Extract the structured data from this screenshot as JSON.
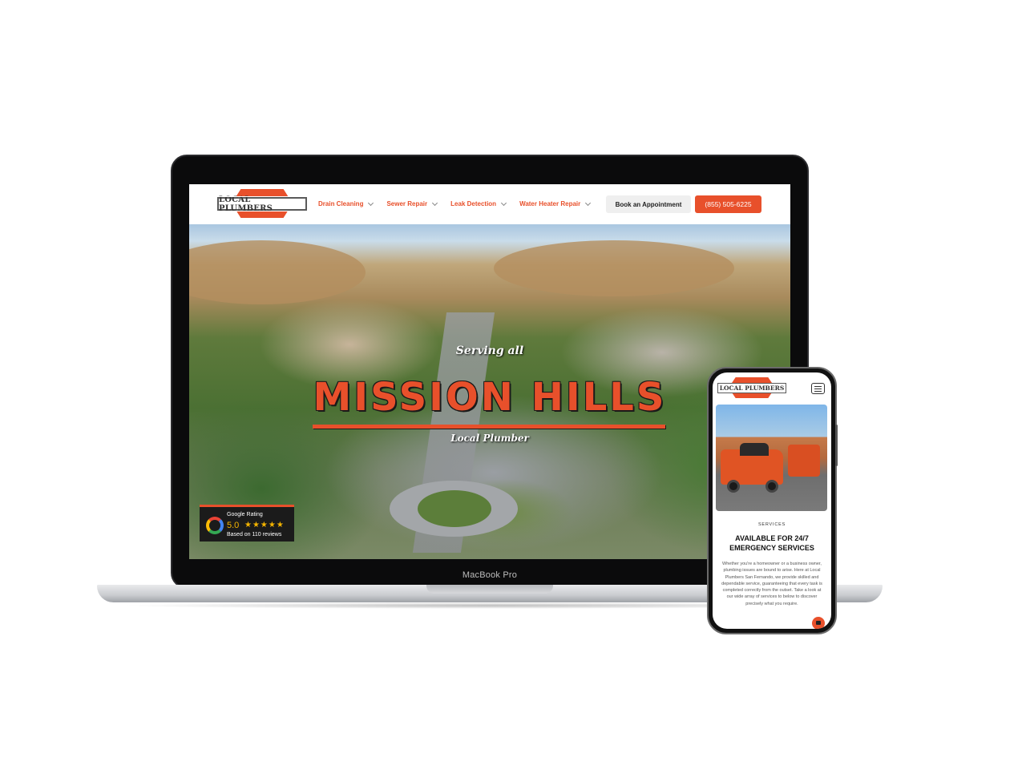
{
  "laptop": {
    "brand": "MacBook Pro",
    "site": {
      "logo_text": "LOCAL PLUMBERS",
      "nav": [
        {
          "label": "Drain Cleaning"
        },
        {
          "label": "Sewer Repair"
        },
        {
          "label": "Leak Detection"
        },
        {
          "label": "Water Heater Repair"
        }
      ],
      "book_label": "Book an Appointment",
      "phone_label": "(855) 505-6225",
      "hero": {
        "serving": "Serving all",
        "title": "MISSION HILLS",
        "subtitle": "Local Plumber"
      },
      "rating": {
        "label": "Google Rating",
        "score": "5.0",
        "stars": "★★★★★",
        "reviews": "Based on 110 reviews"
      }
    }
  },
  "phone": {
    "logo_text": "LOCAL PLUMBERS",
    "eyebrow": "SERVICES",
    "title": "AVAILABLE FOR 24/7 EMERGENCY SERVICES",
    "body": "Whether you're a homeowner or a business owner, plumbing issues are bound to arise. Here at Local Plumbers San Fernando, we provide skilled and dependable service, guaranteeing that every task is completed correctly from the outset. Take a look at our wide array of services to below to discover precisely what you require."
  },
  "colors": {
    "accent": "#e8502b",
    "star": "#f4b400"
  }
}
